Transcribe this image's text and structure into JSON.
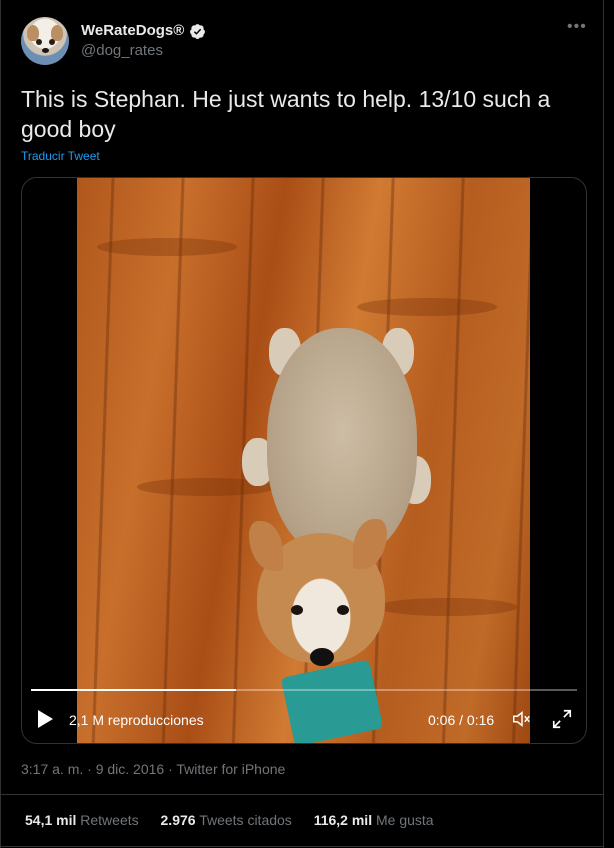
{
  "author": {
    "name": "WeRateDogs®",
    "handle": "@dog_rates",
    "verified": true,
    "avatar_icon": "dog-avatar"
  },
  "tweet": {
    "text": "This is Stephan. He just wants to help. 13/10 such a good boy",
    "translate_label": "Traducir Tweet",
    "more_label": "•••"
  },
  "video": {
    "views_label": "2,1 M reproducciones",
    "time_label": "0:06 / 0:16",
    "progress": 0.375,
    "play_icon": "play-icon",
    "volume_icon": "volume-icon",
    "fullscreen_icon": "fullscreen-icon"
  },
  "meta": {
    "text": "3:17 a. m. · 9 dic. 2016 · Twitter for iPhone"
  },
  "stats": {
    "retweets_count": "54,1 mil",
    "retweets_label": "Retweets",
    "quotes_count": "2.976",
    "quotes_label": "Tweets citados",
    "likes_count": "116,2 mil",
    "likes_label": "Me gusta"
  },
  "colors": {
    "background": "#000000",
    "text": "#e7e9ea",
    "secondary": "#71767b",
    "link": "#1d9bf0",
    "border": "#2f3336"
  }
}
